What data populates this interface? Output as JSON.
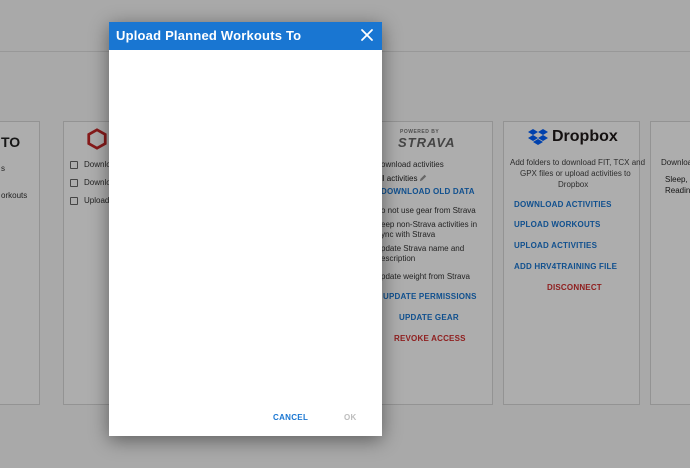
{
  "dialog": {
    "title": "Upload Planned Workouts To",
    "cancel_label": "CANCEL",
    "ok_label": "OK"
  },
  "cards": {
    "left_partial": {
      "logo_text": "TO",
      "line1": "s",
      "line2": "orkouts"
    },
    "second": {
      "items": [
        "Downlo",
        "Downlo",
        "Upload"
      ]
    },
    "strava": {
      "powered_by": "POWERED BY",
      "brand": "STRAVA",
      "download_activities": "ownload activities",
      "all_activities": "ll activities",
      "download_old_data": "DOWNLOAD OLD DATA",
      "opt1": "o not use gear from Strava",
      "opt2a": "eep non-Strava activities in",
      "opt2b": "ync with Strava",
      "opt3a": "pdate Strava name and",
      "opt3b": "escription",
      "opt4": "pdate weight from Strava",
      "update_permissions": "UPDATE PERMISSIONS",
      "update_gear": "UPDATE GEAR",
      "revoke_access": "REVOKE ACCESS"
    },
    "dropbox": {
      "brand": "Dropbox",
      "desc1": "Add folders to download FIT, TCX and",
      "desc2": "GPX files or upload activities to",
      "desc3": "Dropbox",
      "download_activities": "DOWNLOAD ACTIVITIES",
      "upload_workouts": "UPLOAD WORKOUTS",
      "upload_activities": "UPLOAD ACTIVITIES",
      "add_file": "ADD HRV4TRAINING FILE",
      "disconnect": "DISCONNECT"
    },
    "right_partial": {
      "line1": "Downloa",
      "line2": "Sleep, R",
      "line3": "Readin"
    }
  },
  "icons": {
    "close": "close-icon",
    "dropbox": "dropbox-logo-icon",
    "second_logo": "hexagon-logo-icon",
    "edit": "pencil-icon"
  },
  "colors": {
    "accent": "#1976d2",
    "danger": "#d32f2f",
    "strava": "#fc4c02"
  }
}
